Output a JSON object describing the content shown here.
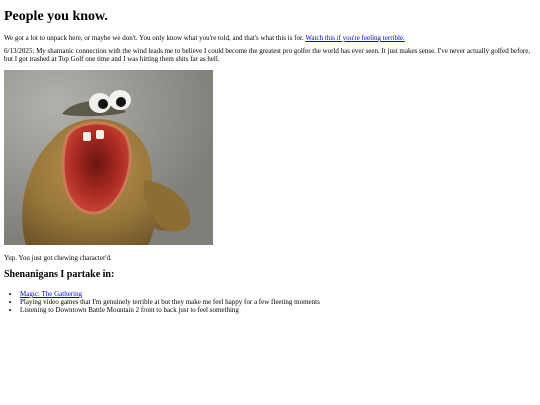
{
  "heading": "People you know.",
  "intro": {
    "text": "We got a lot to unpack here, or maybe we don't. You only know what you're told, and that's what this is for.",
    "link_text": "Watch this if you're feeling terrible."
  },
  "entry": {
    "text": "6/13/2025: My shamanic connection with the wind leads me to believe I could become the greatest pro golfer the world has ever seen. It just makes sense. I've never actually golfed before, but I got trashed at Top Golf one time and I was hitting them shits far as hell."
  },
  "photo": {
    "subject": "claymation creature with big eyes and wide open mouth",
    "colors": {
      "background": "#8f8d87",
      "body": "#9a7a3c",
      "mouth": "#b8322a"
    }
  },
  "caption": "Yup. You just got chewing character'd.",
  "section_heading": "Shenanigans I partake in:",
  "hobbies": [
    {
      "label": "Magic: The Gathering",
      "is_link": true
    },
    {
      "label": "Playing video games that I'm genuinely terrible at but they make me feel happy for a few fleeting moments",
      "is_link": false
    },
    {
      "label": "Listening to Downtown Battle Mountain 2 front to back just to feel something",
      "is_link": false
    }
  ],
  "colors": {
    "link": "#0000ee",
    "text": "#000000",
    "background": "#ffffff"
  }
}
